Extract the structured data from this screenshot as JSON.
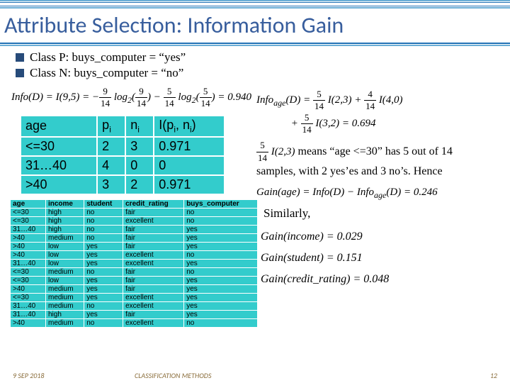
{
  "title": "Attribute Selection: Information Gain",
  "bullets": {
    "p": "Class P: buys_computer = “yes”",
    "n": "Class N: buys_computer = “no”"
  },
  "infoD_formula": "Info(D) = I(9,5) = − (9/14) log₂(9/14) − (5/14) log₂(5/14) = 0.940",
  "small_table": {
    "headers": [
      "age",
      "pᵢ",
      "nᵢ",
      "I(pᵢ, nᵢ)"
    ],
    "rows": [
      [
        "<=30",
        "2",
        "3",
        "0.971"
      ],
      [
        "31…40",
        "4",
        "0",
        "0"
      ],
      [
        ">40",
        "3",
        "2",
        "0.971"
      ]
    ]
  },
  "big_table": {
    "headers": [
      "age",
      "income",
      "student",
      "credit_rating",
      "buys_computer"
    ],
    "rows": [
      [
        "<=30",
        "high",
        "no",
        "fair",
        "no"
      ],
      [
        "<=30",
        "high",
        "no",
        "excellent",
        "no"
      ],
      [
        "31…40",
        "high",
        "no",
        "fair",
        "yes"
      ],
      [
        ">40",
        "medium",
        "no",
        "fair",
        "yes"
      ],
      [
        ">40",
        "low",
        "yes",
        "fair",
        "yes"
      ],
      [
        ">40",
        "low",
        "yes",
        "excellent",
        "no"
      ],
      [
        "31…40",
        "low",
        "yes",
        "excellent",
        "yes"
      ],
      [
        "<=30",
        "medium",
        "no",
        "fair",
        "no"
      ],
      [
        "<=30",
        "low",
        "yes",
        "fair",
        "yes"
      ],
      [
        ">40",
        "medium",
        "yes",
        "fair",
        "yes"
      ],
      [
        "<=30",
        "medium",
        "yes",
        "excellent",
        "yes"
      ],
      [
        "31…40",
        "medium",
        "no",
        "excellent",
        "yes"
      ],
      [
        "31…40",
        "high",
        "yes",
        "fair",
        "yes"
      ],
      [
        ">40",
        "medium",
        "no",
        "excellent",
        "no"
      ]
    ]
  },
  "info_age_eq": "Infoₐₑ(D) = (5/14) I(2,3) + (4/14) I(4,0) + (5/14) I(3,2) = 0.694",
  "i23_prefix": "(5/14) I(2,3)",
  "explain_text": " means “age <=30” has 5 out of 14 samples, with 2 yes’es  and 3 no’s.   Hence",
  "gain_age": "Gain(age) = Info(D) − Infoₐₑ(D) = 0.246",
  "similarly": "Similarly,",
  "gains": {
    "income": "Gain(income) = 0.029",
    "student": "Gain(student) = 0.151",
    "credit": "Gain(credit_rating) = 0.048"
  },
  "footer": {
    "left": "9 SEP 2018",
    "center": "CLASSIFICATION METHODS",
    "right": "12"
  }
}
